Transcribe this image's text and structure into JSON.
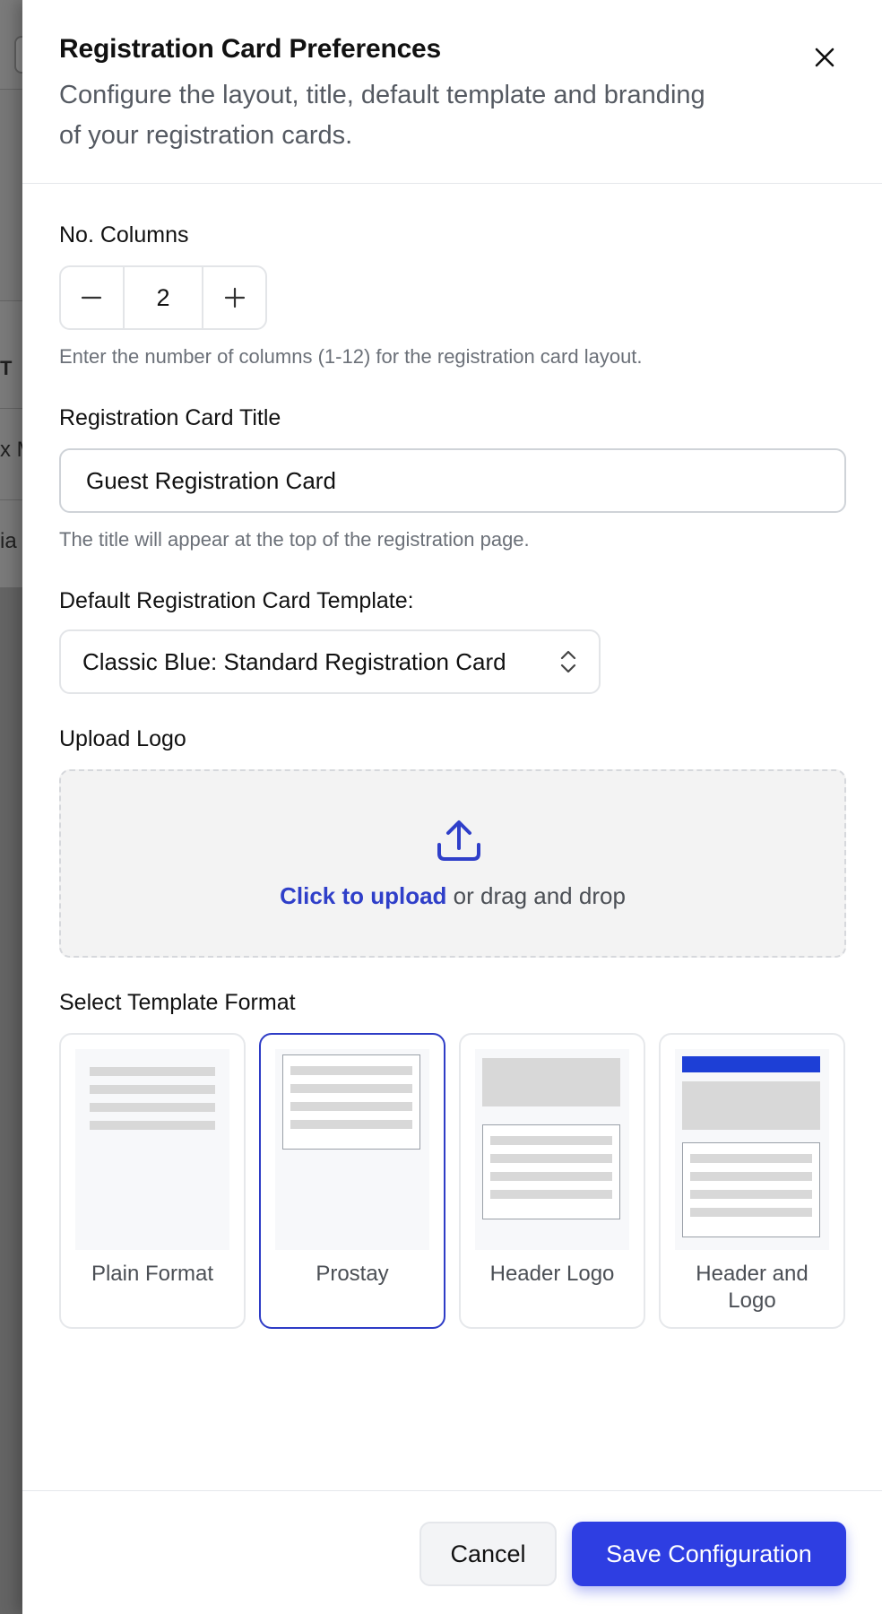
{
  "background": {
    "row_texts": [
      "T",
      "x M",
      "ia"
    ]
  },
  "dialog": {
    "title": "Registration Card Preferences",
    "subtitle": "Configure the layout, title, default template and branding of your registration cards.",
    "close_icon": "close-icon"
  },
  "columns": {
    "label": "No. Columns",
    "value": "2",
    "help": "Enter the number of columns (1-12) for the registration card layout.",
    "decrement_icon": "minus-icon",
    "increment_icon": "plus-icon"
  },
  "card_title": {
    "label": "Registration Card Title",
    "value": "Guest Registration Card",
    "help": "The title will appear at the top of the registration page."
  },
  "default_template": {
    "label": "Default Registration Card Template:",
    "selected": "Classic Blue: Standard Registration Card",
    "icon": "chevron-up-down-icon"
  },
  "upload": {
    "label": "Upload Logo",
    "link_text": "Click to upload",
    "rest_text": " or drag and drop",
    "icon": "upload-icon"
  },
  "template_format": {
    "label": "Select Template Format",
    "selected_index": 1,
    "options": [
      {
        "label": "Plain Format"
      },
      {
        "label": "Prostay"
      },
      {
        "label": "Header Logo"
      },
      {
        "label": "Header and Logo"
      }
    ]
  },
  "footer": {
    "cancel_label": "Cancel",
    "save_label": "Save Configuration"
  },
  "colors": {
    "accent": "#2e3ee2",
    "selected_border": "#2e3cc6",
    "link": "#2f3fc9",
    "header_bar": "#1d3fd6"
  }
}
